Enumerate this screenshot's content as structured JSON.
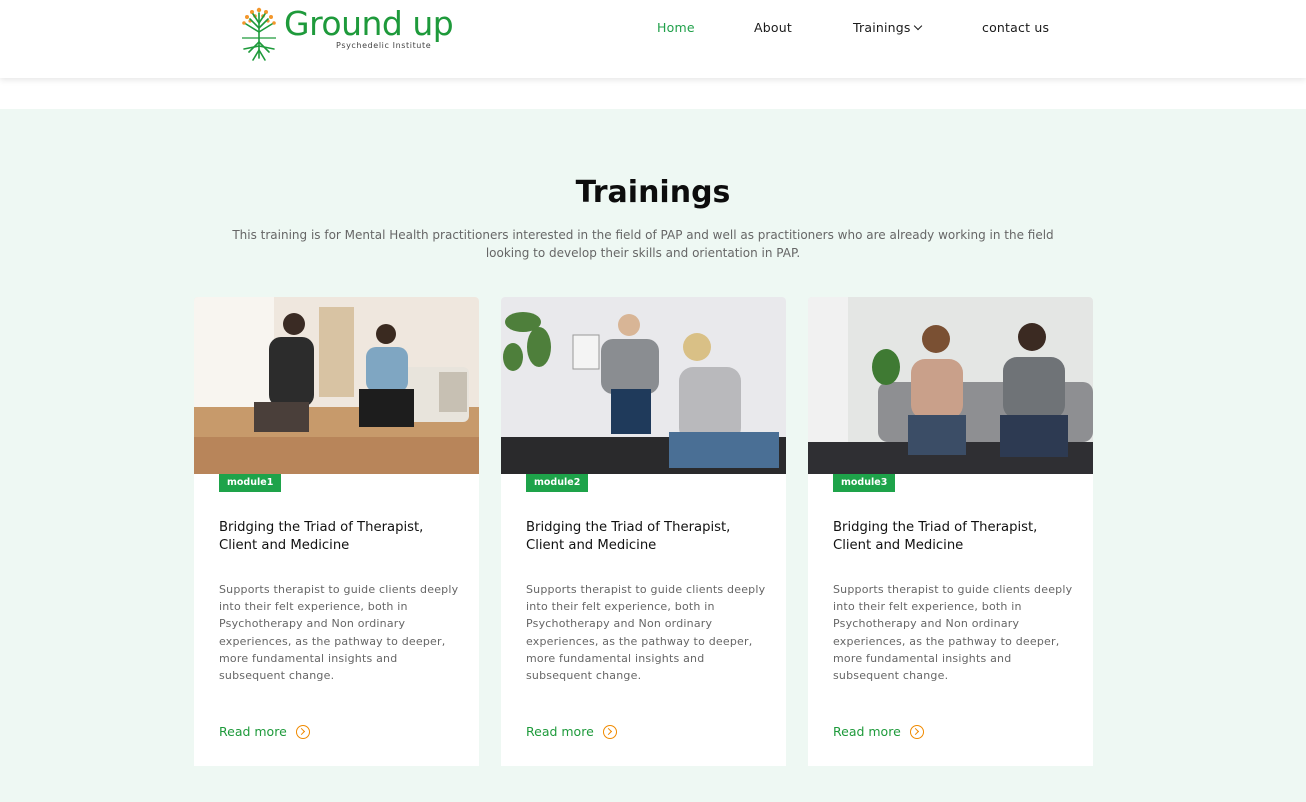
{
  "brand": {
    "name": "Ground up",
    "tagline": "Psychedelic Institute"
  },
  "nav": {
    "items": [
      {
        "label": "Home",
        "active": true
      },
      {
        "label": "About",
        "active": false
      },
      {
        "label": "Trainings",
        "active": false,
        "has_dropdown": true
      },
      {
        "label": "contact us",
        "active": false
      }
    ]
  },
  "trainings": {
    "title": "Trainings",
    "description": "This training is for Mental Health practitioners interested in the field of PAP and well as practitioners who are already working in the field looking to develop their skills and orientation in PAP.",
    "cards": [
      {
        "badge": "module1",
        "title": "Bridging the Triad of Therapist, Client and Medicine",
        "description": "Supports therapist to guide clients deeply into their felt experience, both in Psychotherapy and Non ordinary experiences, as the pathway to deeper, more fundamental insights and subsequent change.",
        "link": "Read more"
      },
      {
        "badge": "module2",
        "title": "Bridging the Triad of Therapist, Client and Medicine",
        "description": "Supports therapist to guide clients deeply into their felt experience, both in Psychotherapy and Non ordinary experiences, as the pathway to deeper, more fundamental insights and subsequent change.",
        "link": "Read more"
      },
      {
        "badge": "module3",
        "title": "Bridging the Triad of Therapist, Client and Medicine",
        "description": "Supports therapist to guide clients deeply into their felt experience, both in Psychotherapy and Non ordinary experiences, as the pathway to deeper, more fundamental insights and subsequent change.",
        "link": "Read more"
      }
    ]
  },
  "colors": {
    "brand_green": "#1e9a3b",
    "badge_green": "#1ea34a",
    "accent_orange": "#f08a00",
    "section_bg": "#eef8f3"
  }
}
